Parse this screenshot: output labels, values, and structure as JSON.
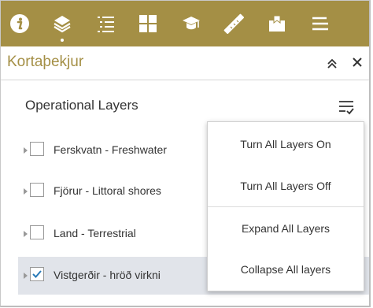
{
  "toolbar": {
    "color": "#a48f45",
    "tools": [
      {
        "icon": "info-icon"
      },
      {
        "icon": "layers-icon",
        "active": true
      },
      {
        "icon": "legend-list-icon"
      },
      {
        "icon": "basemap-grid-icon"
      },
      {
        "icon": "graduation-cap-icon"
      },
      {
        "icon": "ruler-icon"
      },
      {
        "icon": "print-bookmark-icon"
      },
      {
        "icon": "more-menu-icon"
      }
    ]
  },
  "panel": {
    "title": "Kortaþekjur",
    "collapse_icon": "double-chevron-up-icon",
    "close_icon": "close-icon"
  },
  "layer_list": {
    "heading": "Operational Layers",
    "options_icon": "layer-options-icon",
    "layers": [
      {
        "label": "Ferskvatn - Freshwater",
        "checked": false,
        "selected": false
      },
      {
        "label": "Fjörur - Littoral shores",
        "checked": false,
        "selected": false
      },
      {
        "label": "Land - Terrestrial",
        "checked": false,
        "selected": false
      },
      {
        "label": "Vistgerðir - hröð virkni",
        "checked": true,
        "selected": true
      }
    ]
  },
  "options_menu": {
    "turn_all_on": "Turn All Layers On",
    "turn_all_off": "Turn All Layers Off",
    "expand_all": "Expand All Layers",
    "collapse_all": "Collapse All layers"
  },
  "colors": {
    "accent": "#a48f45",
    "selected_row": "#e1e4ea",
    "check": "#2a7ab8"
  }
}
